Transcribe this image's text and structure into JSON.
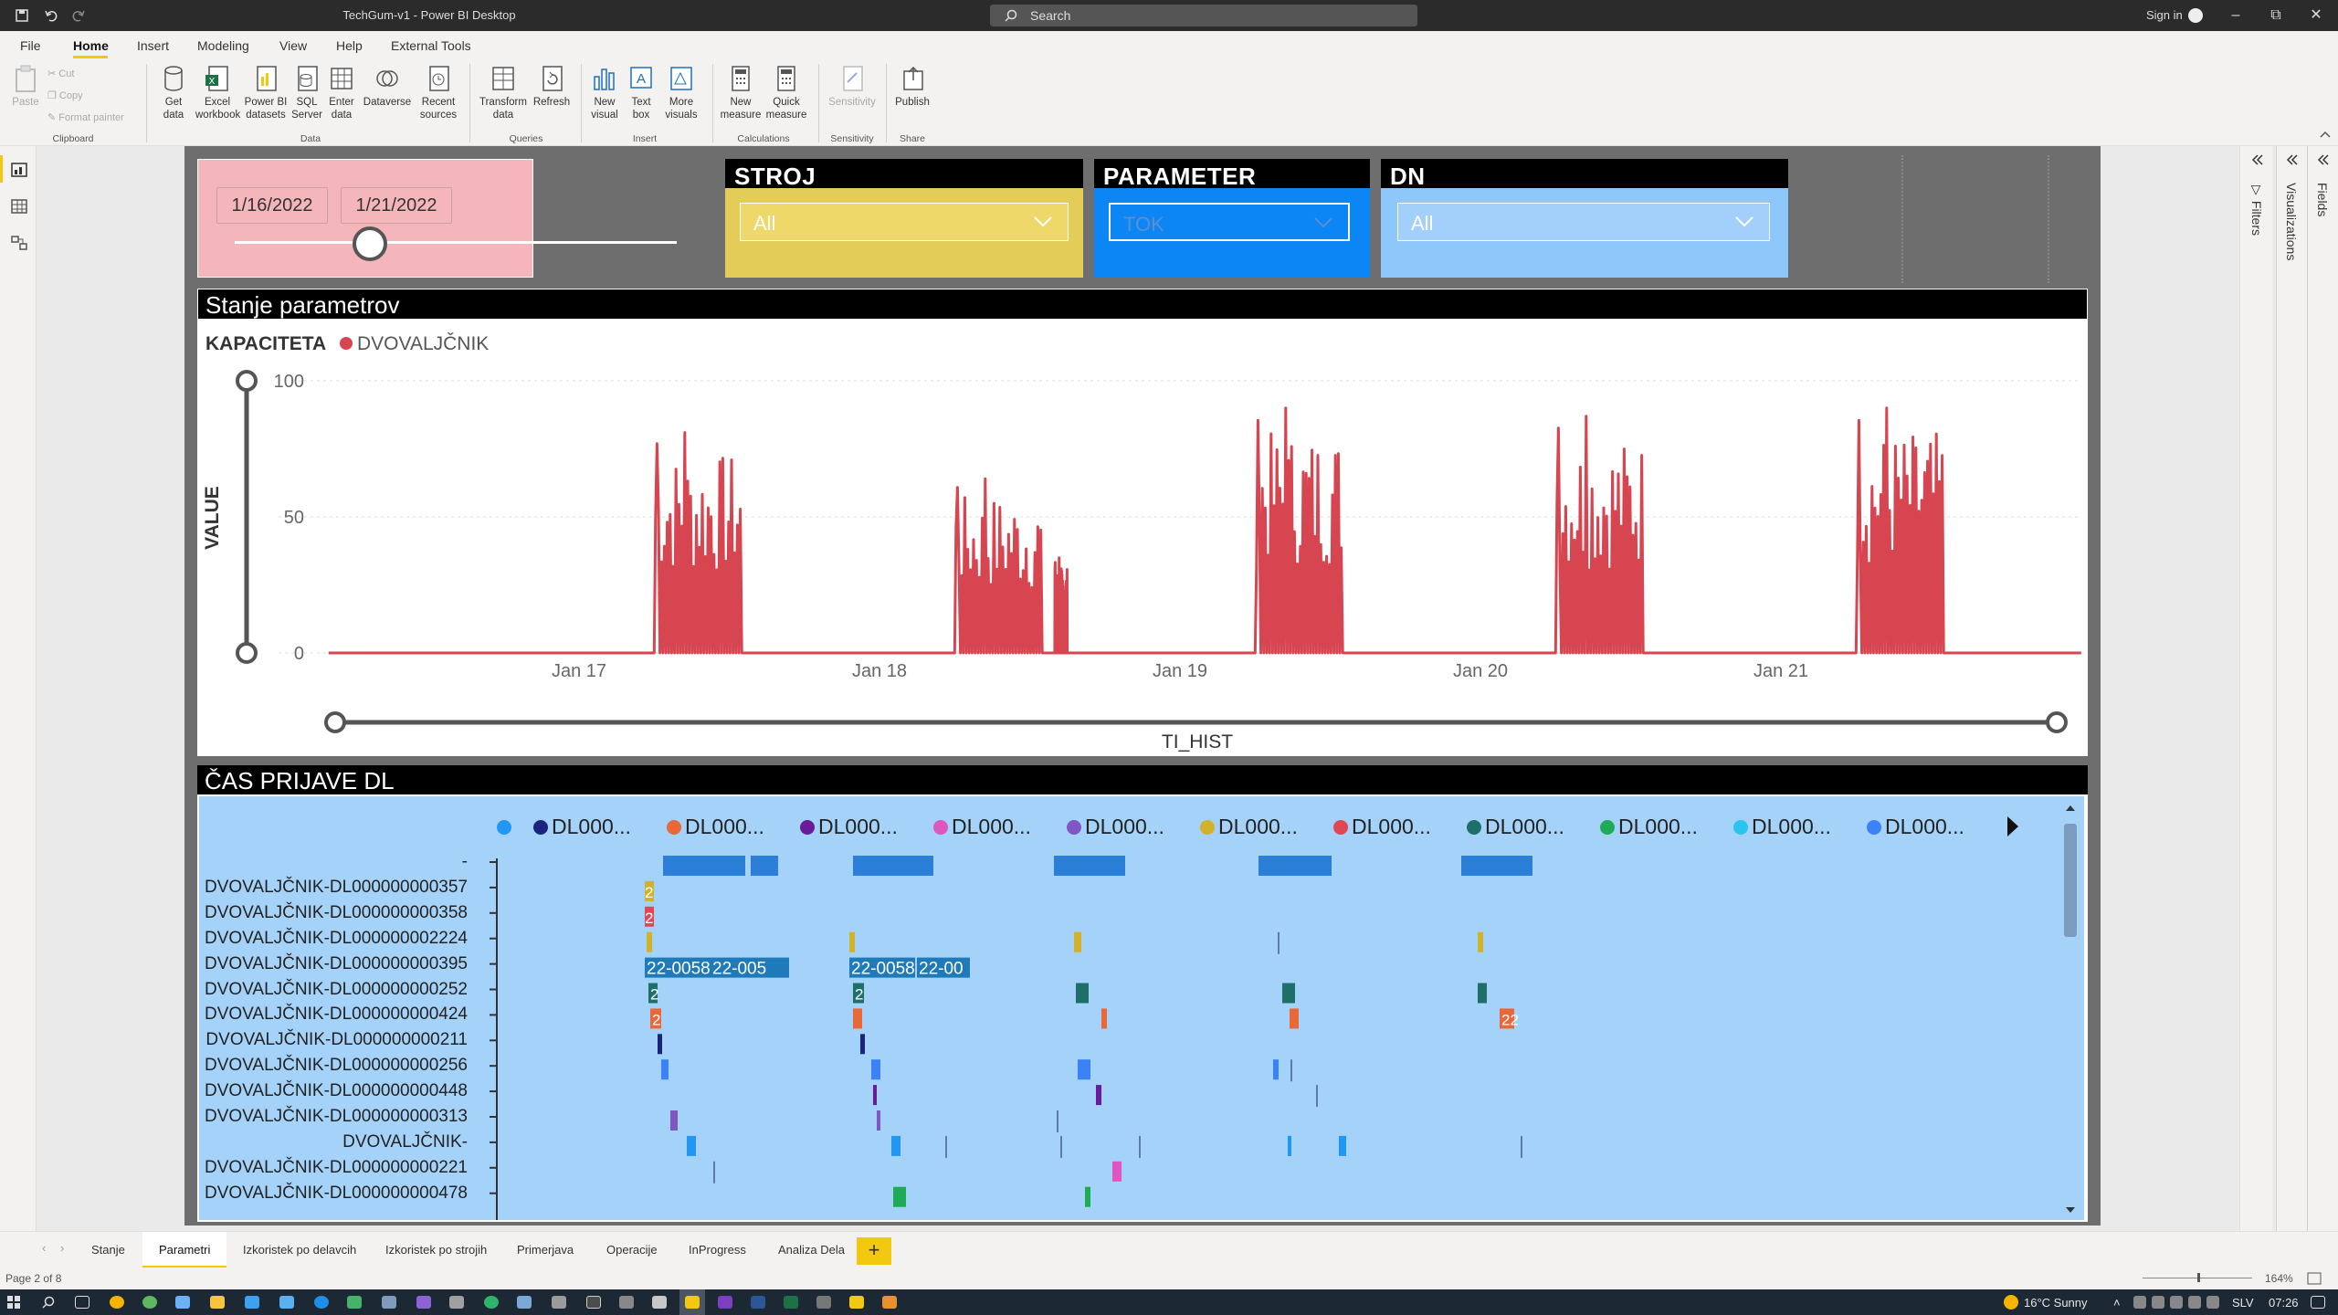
{
  "window": {
    "title": "TechGum-v1 - Power BI Desktop",
    "search_placeholder": "Search",
    "sign_in": "Sign in"
  },
  "menu": [
    "File",
    "Home",
    "Insert",
    "Modeling",
    "View",
    "Help",
    "External Tools"
  ],
  "ribbon": {
    "clipboard": {
      "paste": "Paste",
      "cut": "Cut",
      "copy": "Copy",
      "format_painter": "Format painter",
      "group": "Clipboard"
    },
    "data": {
      "get_data": "Get data",
      "excel": "Excel workbook",
      "pbi_datasets": "Power BI datasets",
      "sql": "SQL Server",
      "enter_data": "Enter data",
      "dataverse": "Dataverse",
      "recent": "Recent sources",
      "group": "Data"
    },
    "queries": {
      "transform": "Transform data",
      "refresh": "Refresh",
      "group": "Queries"
    },
    "insert": {
      "new_visual": "New visual",
      "text_box": "Text box",
      "more_visuals": "More visuals",
      "group": "Insert"
    },
    "calculations": {
      "new_measure": "New measure",
      "quick_measure": "Quick measure",
      "group": "Calculations"
    },
    "sensitivity": {
      "sensitivity": "Sensitivity",
      "group": "Sensitivity"
    },
    "share": {
      "publish": "Publish",
      "group": "Share"
    }
  },
  "panes": {
    "filters": "Filters",
    "visualizations": "Visualizations",
    "fields": "Fields"
  },
  "slicers": {
    "date": {
      "start": "1/16/2022",
      "end": "1/21/2022",
      "slider_position": 0.53
    },
    "stroj": {
      "title": "STROJ",
      "value": "All"
    },
    "parameter": {
      "title": "PARAMETER",
      "value": "TOK"
    },
    "dn": {
      "title": "DN",
      "value": "All"
    }
  },
  "line_visual": {
    "title": "Stanje parametrov"
  },
  "chart_data": {
    "type": "line",
    "legend_title": "KAPACITETA",
    "series": [
      {
        "name": "DVOVALJČNIK",
        "color": "#d64550"
      }
    ],
    "xlabel": "TI_HIST",
    "ylabel": "VALUE",
    "ylim": [
      0,
      100
    ],
    "yticks": [
      "0",
      "50",
      "100"
    ],
    "xticks": [
      "Jan 17",
      "Jan 18",
      "Jan 19",
      "Jan 20",
      "Jan 21"
    ],
    "xlim": [
      "2022-01-16",
      "2022-01-22"
    ],
    "grid": true,
    "legend_position": "top-left",
    "bursts": [
      {
        "start": "2022-01-17 06:00",
        "end": "2022-01-17 13:00",
        "peak": 81
      },
      {
        "start": "2022-01-18 06:00",
        "end": "2022-01-18 13:00",
        "peak": 64
      },
      {
        "start": "2022-01-18 14:00",
        "end": "2022-01-18 15:00",
        "peak": 35
      },
      {
        "start": "2022-01-19 06:00",
        "end": "2022-01-19 13:00",
        "peak": 90
      },
      {
        "start": "2022-01-20 06:00",
        "end": "2022-01-20 13:00",
        "peak": 87
      },
      {
        "start": "2022-01-21 06:00",
        "end": "2022-01-21 13:00",
        "peak": 90
      }
    ]
  },
  "gantt": {
    "title": "ČAS PRIJAVE DL",
    "legend": [
      {
        "label": "",
        "color": "#2196f3"
      },
      {
        "label": "DL000...",
        "color": "#1a237e"
      },
      {
        "label": "DL000...",
        "color": "#e8683a"
      },
      {
        "label": "DL000...",
        "color": "#6a1b9a"
      },
      {
        "label": "DL000...",
        "color": "#e056c1"
      },
      {
        "label": "DL000...",
        "color": "#7e57c2"
      },
      {
        "label": "DL000...",
        "color": "#d4b12a"
      },
      {
        "label": "DL000...",
        "color": "#e04656"
      },
      {
        "label": "DL000...",
        "color": "#1e6f6a"
      },
      {
        "label": "DL000...",
        "color": "#1faa55"
      },
      {
        "label": "DL000...",
        "color": "#29c5f0"
      },
      {
        "label": "DL000...",
        "color": "#3b82f6"
      }
    ],
    "rows": [
      "-",
      "DVOVALJČNIK-DL000000000357",
      "DVOVALJČNIK-DL000000000358",
      "DVOVALJČNIK-DL000000002224",
      "DVOVALJČNIK-DL000000000395",
      "DVOVALJČNIK-DL000000000252",
      "DVOVALJČNIK-DL000000000424",
      "DVOVALJČNIK-DL000000000211",
      "DVOVALJČNIK-DL000000000256",
      "DVOVALJČNIK-DL000000000448",
      "DVOVALJČNIK-DL000000000313",
      "DVOVALJČNIK-",
      "DVOVALJČNIK-DL000000000221",
      "DVOVALJČNIK-DL000000000478"
    ],
    "bar_labels": [
      "22-0058",
      "22-005",
      "22-0058",
      "22-00",
      "2",
      "22"
    ]
  },
  "tabs": [
    "Stanje",
    "Parametri",
    "Izkoristek po delavcih",
    "Izkoristek po strojih",
    "Primerjava",
    "Operacije",
    "InProgress",
    "Analiza Dela"
  ],
  "status": {
    "page": "Page 2 of 8",
    "zoom": "164%"
  },
  "taskbar": {
    "weather": "16°C  Sunny",
    "lang": "SLV",
    "time": "07:26"
  }
}
